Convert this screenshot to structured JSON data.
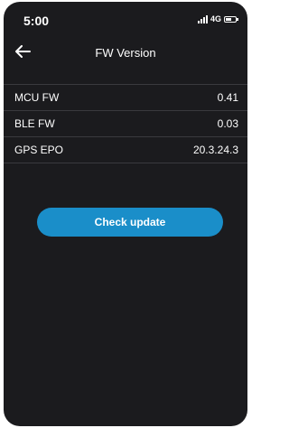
{
  "status_bar": {
    "time": "5:00",
    "network": "4G"
  },
  "nav": {
    "title": "FW Version"
  },
  "firmware": [
    {
      "label": "MCU FW",
      "value": "0.41"
    },
    {
      "label": "BLE FW",
      "value": "0.03"
    },
    {
      "label": "GPS EPO",
      "value": "20.3.24.3"
    }
  ],
  "actions": {
    "check_update_label": "Check update"
  },
  "colors": {
    "background": "#1b1b1e",
    "accent": "#1a8ec9",
    "divider": "#3a3a3e"
  }
}
